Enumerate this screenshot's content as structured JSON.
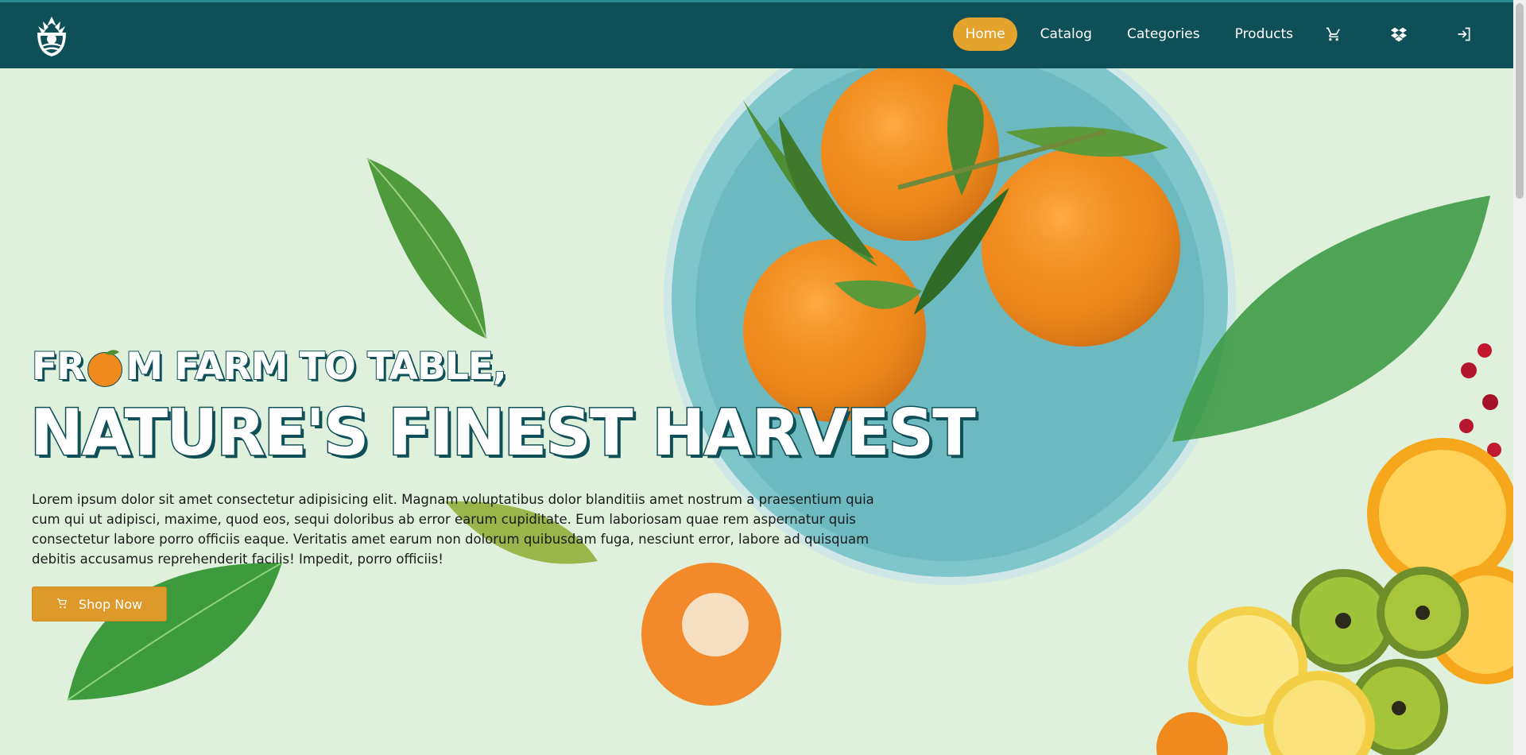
{
  "nav": {
    "items": [
      {
        "label": "Home",
        "active": true
      },
      {
        "label": "Catalog",
        "active": false
      },
      {
        "label": "Categories",
        "active": false
      },
      {
        "label": "Products",
        "active": false
      }
    ],
    "icons": [
      "cart-icon",
      "dropbox-icon",
      "login-icon"
    ]
  },
  "hero": {
    "headline_line1_part1": "FR",
    "headline_line1_part2": "M FARM TO TABLE,",
    "headline_line2": "NATURE'S FINEST HARVEST",
    "description": "Lorem ipsum dolor sit amet consectetur adipisicing elit. Magnam voluptatibus dolor blanditiis amet nostrum a praesentium quia cum qui ut adipisci, maxime, quod eos, sequi doloribus ab error earum cupiditate. Eum laboriosam quae rem aspernatur quis consectetur labore porro officiis eaque. Veritatis amet earum non dolorum quibusdam fuga, nesciunt error, labore ad quisquam debitis accusamus reprehenderit facilis! Impedit, porro officiis!",
    "cta_label": "Shop Now"
  },
  "colors": {
    "header_bg": "#0f4f58",
    "accent": "#e3a32d",
    "page_bg": "#dff1dc"
  }
}
